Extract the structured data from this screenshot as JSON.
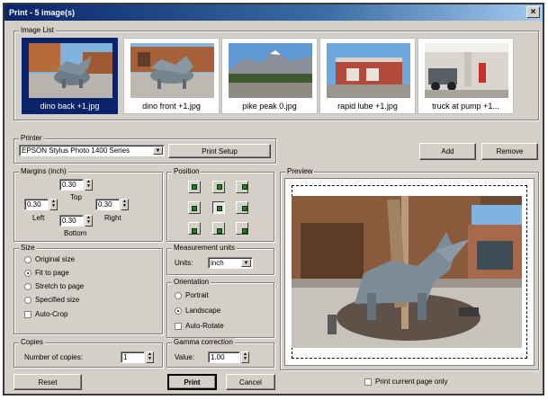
{
  "window": {
    "title": "Print - 5 image(s)",
    "close": "×"
  },
  "image_list": {
    "title": "Image List",
    "items": [
      {
        "caption": "dino back +1.jpg",
        "selected": true
      },
      {
        "caption": "dino front +1.jpg",
        "selected": false
      },
      {
        "caption": "pike peak 0.jpg",
        "selected": false
      },
      {
        "caption": "rapid lube +1.jpg",
        "selected": false
      },
      {
        "caption": "truck at pump +1...",
        "selected": false
      }
    ]
  },
  "printer": {
    "title": "Printer",
    "selected": "EPSON Stylus Photo 1400 Series",
    "setup_label": "Print Setup"
  },
  "list_buttons": {
    "add": "Add",
    "remove": "Remove"
  },
  "margins": {
    "title": "Margins (inch)",
    "top_label": "Top",
    "left_label": "Left",
    "right_label": "Right",
    "bottom_label": "Bottom",
    "top": "0.30",
    "left": "0.30",
    "right": "0.30",
    "bottom": "0.30"
  },
  "position": {
    "title": "Position",
    "selected_index": 4
  },
  "size": {
    "title": "Size",
    "options": [
      "Original size",
      "Fit to page",
      "Stretch to page",
      "Specified size"
    ],
    "selected_index": 1,
    "auto_crop": "Auto-Crop"
  },
  "measurement": {
    "title": "Measurement units",
    "units_label": "Units:",
    "units_value": "inch"
  },
  "orientation": {
    "title": "Orientation",
    "options": [
      "Portrait",
      "Landscape"
    ],
    "selected_index": 1,
    "auto_rotate": "Auto-Rotate"
  },
  "copies": {
    "title": "Copies",
    "label": "Number of copies:",
    "value": "1"
  },
  "gamma": {
    "title": "Gamma correction",
    "label": "Value:",
    "value": "1.00"
  },
  "preview": {
    "title": "Preview",
    "current_page_only": "Print current page only"
  },
  "footer": {
    "reset": "Reset",
    "print": "Print",
    "cancel": "Cancel"
  },
  "colors": {
    "title_start": "#0a246a",
    "title_end": "#a6caf0",
    "dialog_bg": "#d4d0c8",
    "selection": "#0a246a",
    "position_icon": "#2a7a2a"
  }
}
